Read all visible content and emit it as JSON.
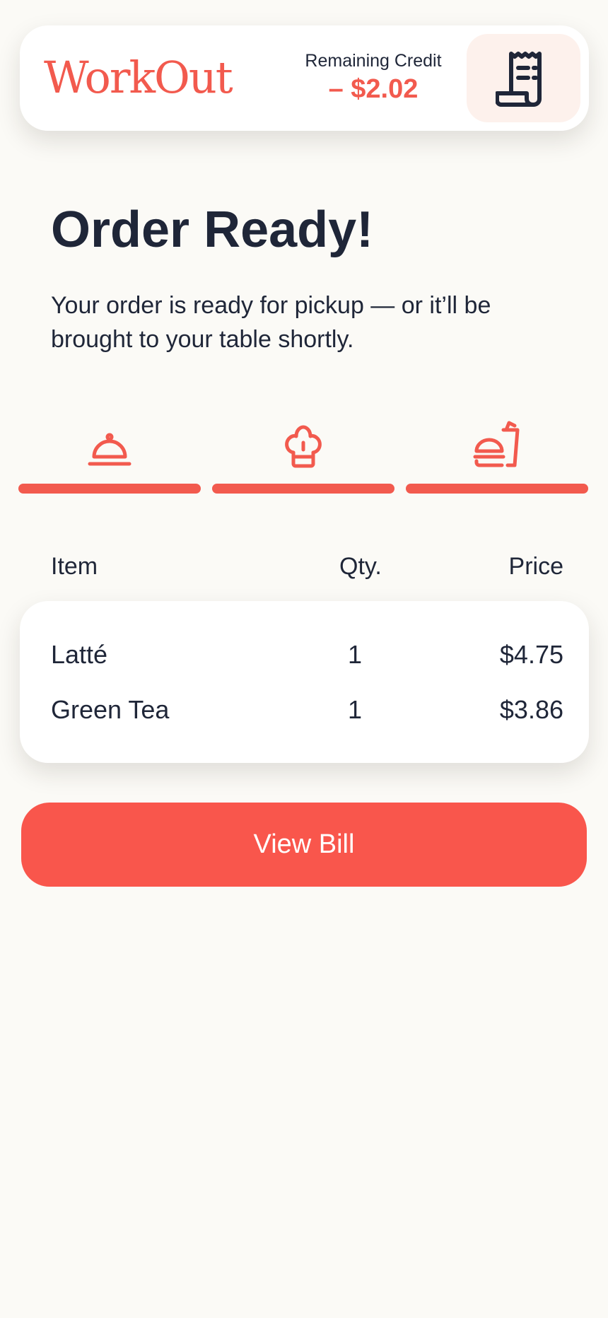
{
  "header": {
    "logo": "WorkOut",
    "credit_label": "Remaining Credit",
    "credit_value": "– $2.02",
    "receipt_icon": "receipt-icon"
  },
  "main": {
    "title": "Order Ready!",
    "subtitle": "Your order is ready for pickup — or it’ll be brought to your table shortly."
  },
  "progress": {
    "steps": [
      {
        "icon": "cloche-icon",
        "complete": true
      },
      {
        "icon": "chef-hat-icon",
        "complete": true
      },
      {
        "icon": "food-drink-icon",
        "complete": true
      }
    ]
  },
  "table": {
    "headers": {
      "item": "Item",
      "qty": "Qty.",
      "price": "Price"
    },
    "rows": [
      {
        "item": "Latté",
        "qty": "1",
        "price": "$4.75"
      },
      {
        "item": "Green Tea",
        "qty": "1",
        "price": "$3.86"
      }
    ]
  },
  "actions": {
    "view_bill": "View Bill"
  },
  "colors": {
    "accent": "#F25A4E",
    "text": "#1F2638",
    "background": "#FBFAF6"
  }
}
